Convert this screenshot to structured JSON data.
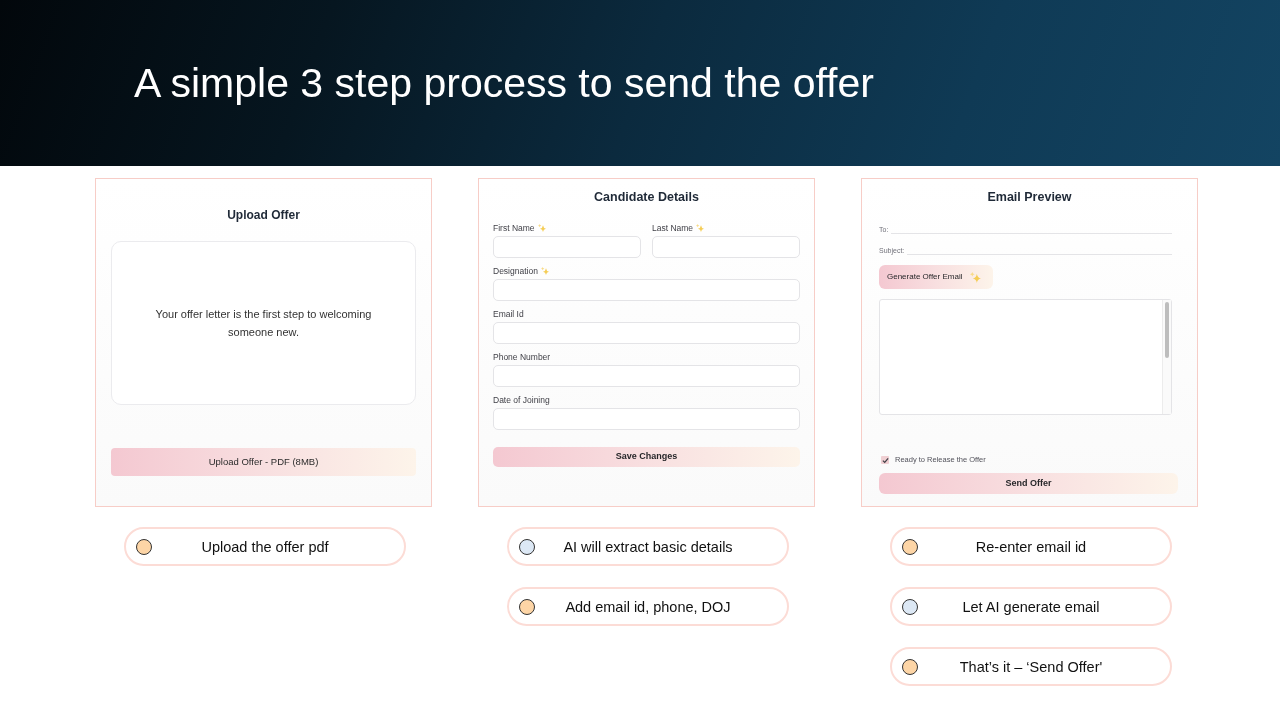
{
  "title": "A simple 3 step process to send the offer",
  "steps": [
    {
      "kind": "upload",
      "panel": {
        "title": "Upload Offer",
        "dropzone_text": "Your offer letter is the first step to welcoming someone new.",
        "button": "Upload Offer - PDF (8MB)"
      },
      "notes": [
        {
          "text": "Upload the offer pdf",
          "color": "#fdd5a6"
        }
      ]
    },
    {
      "kind": "details",
      "panel": {
        "title": "Candidate Details",
        "field_rows": [
          [
            {
              "label": "First Name",
              "ai": true
            },
            {
              "label": "Last Name",
              "ai": true
            }
          ],
          [
            {
              "label": "Designation",
              "ai": true
            }
          ],
          [
            {
              "label": "Email Id",
              "ai": false
            }
          ],
          [
            {
              "label": "Phone Number",
              "ai": false
            }
          ],
          [
            {
              "label": "Date of Joining",
              "ai": false
            }
          ]
        ],
        "button": "Save Changes"
      },
      "notes": [
        {
          "text": "AI will extract basic details",
          "color": "#dce8f5"
        },
        {
          "text": "Add email id, phone, DOJ",
          "color": "#fdd5a6"
        }
      ]
    },
    {
      "kind": "email",
      "panel": {
        "title": "Email Preview",
        "fields": [
          {
            "label": "To:"
          },
          {
            "label": "Subject:"
          }
        ],
        "generate_button": "Generate Offer Email",
        "checkbox": {
          "label": "Ready to Release the Offer",
          "checked": true
        },
        "button": "Send Offer"
      },
      "notes": [
        {
          "text": "Re-enter email id",
          "color": "#fdd5a6"
        },
        {
          "text": "Let AI generate email",
          "color": "#dce8f5"
        },
        {
          "text": "That’s it – ‘Send Offer'",
          "color": "#fdd5a6"
        }
      ]
    }
  ]
}
